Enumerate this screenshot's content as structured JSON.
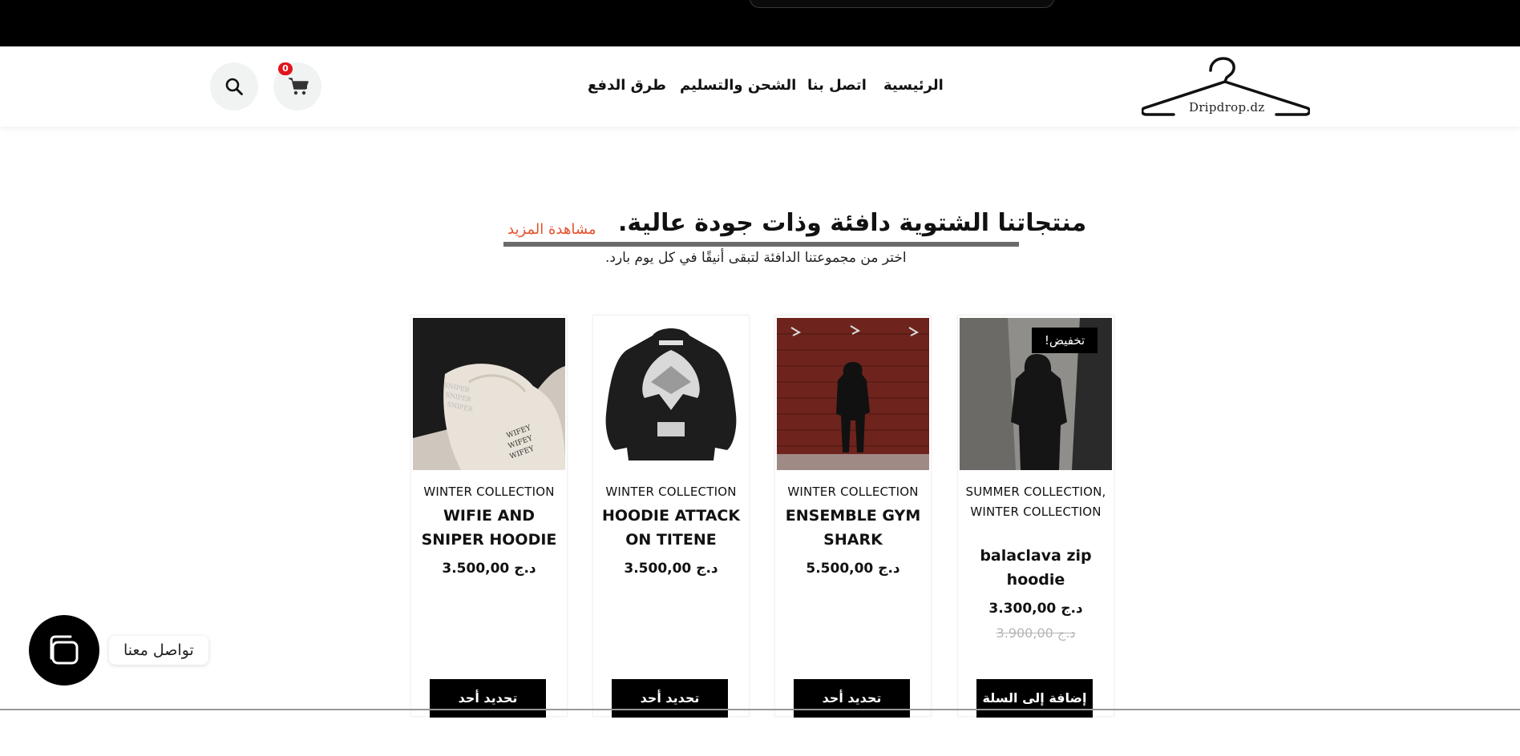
{
  "nav": {
    "home": "الرئيسية",
    "contact": "اتصل بنا",
    "shipping": "الشحن والتسليم",
    "payment": "طرق الدفع"
  },
  "logo": {
    "text": "Dripdrop.dz"
  },
  "cart": {
    "count": "0"
  },
  "section": {
    "title": "منتجاتنا الشتوية دافئة وذات جودة عالية.",
    "see_more": "مشاهدة المزيد",
    "subtitle": "اختر من مجموعتنا الدافئة لتبقى أنيقًا في كل يوم بارد."
  },
  "products": [
    {
      "category": "WINTER COLLECTION",
      "name": "WIFIE AND SNIPER HOODIE",
      "price": "3.500,00 د.ج",
      "button": "تحديد أحد الخيارات"
    },
    {
      "category": "WINTER COLLECTION",
      "name": "HOODIE ATTACK ON TITENE",
      "price": "3.500,00 د.ج",
      "button": "تحديد أحد الخيارات"
    },
    {
      "category": "WINTER COLLECTION",
      "name": "ENSEMBLE GYM SHARK",
      "price": "5.500,00 د.ج",
      "button": "تحديد أحد الخيارات"
    },
    {
      "category": "SUMMER COLLECTION, WINTER COLLECTION",
      "name": "balaclava zip hoodie",
      "price": "3.300,00 د.ج",
      "old_price": "3.900,00 د.ج",
      "badge": "تخفيض!",
      "button": "إضافة إلى السلة"
    }
  ],
  "chat": {
    "label": "تواصل معنا"
  },
  "colors": {
    "topbar": "#000000",
    "accent": "#e5502b",
    "badge": "#e2141c",
    "button": "#000000"
  },
  "icons": [
    "search-icon",
    "cart-icon",
    "hanger-logo",
    "chat-icon"
  ]
}
